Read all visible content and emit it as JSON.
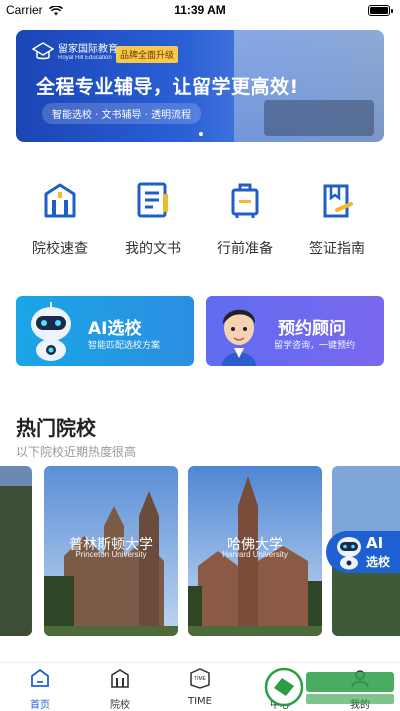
{
  "status_bar": {
    "carrier": "Carrier",
    "time": "11:39 AM"
  },
  "banner": {
    "logo_cn": "留家国际教育",
    "logo_en": "Royal Hill Education",
    "badge": "品牌全面升级",
    "headline": "全程专业辅导，让留学更高效!",
    "subline": "智能选校 · 文书辅导 · 透明流程"
  },
  "quick_actions": [
    {
      "label": "院校速查",
      "icon": "university-icon"
    },
    {
      "label": "我的文书",
      "icon": "document-icon"
    },
    {
      "label": "行前准备",
      "icon": "luggage-icon"
    },
    {
      "label": "签证指南",
      "icon": "visa-icon"
    }
  ],
  "cards": {
    "ai": {
      "title": "AI选校",
      "desc": "智能匹配选校方案"
    },
    "consult": {
      "title": "预约顾问",
      "desc": "留学咨询，一键预约"
    }
  },
  "hot_schools": {
    "title": "热门院校",
    "subtitle": "以下院校近期热度很高",
    "items": [
      {
        "name": "普林斯顿大学",
        "en": "Princeton University"
      },
      {
        "name": "哈佛大学",
        "en": "Harvard University"
      }
    ]
  },
  "float_ai": {
    "line1": "AI",
    "line2": "选校"
  },
  "tabbar": [
    {
      "label": "首页",
      "active": true
    },
    {
      "label": "院校",
      "active": false
    },
    {
      "label": "TIME",
      "active": false
    },
    {
      "label": "中心",
      "active": false
    },
    {
      "label": "我的",
      "active": false
    }
  ],
  "colors": {
    "brand": "#1e62d0",
    "ai_card": "#1aa6e8",
    "consult_card": "#6a6aef",
    "badge": "#f6c94a"
  }
}
